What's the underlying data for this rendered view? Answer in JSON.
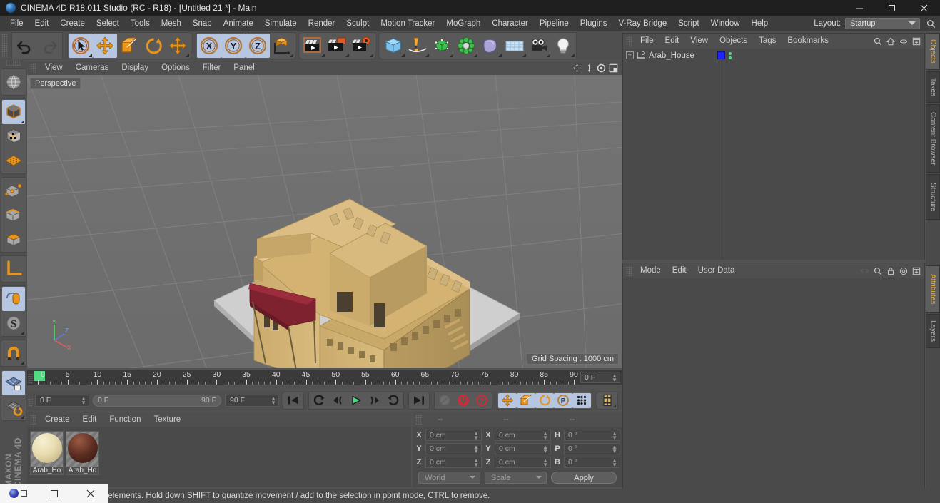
{
  "window": {
    "title": "CINEMA 4D R18.011 Studio (RC - R18) - [Untitled 21 *] - Main",
    "app_icon": "cinema4d-logo-icon",
    "minimize": "minimize-button",
    "maximize": "maximize-button",
    "close": "close-button"
  },
  "menubar": {
    "items": [
      "File",
      "Edit",
      "Create",
      "Select",
      "Tools",
      "Mesh",
      "Snap",
      "Animate",
      "Simulate",
      "Render",
      "Sculpt",
      "Motion Tracker",
      "MoGraph",
      "Character",
      "Pipeline",
      "Plugins",
      "V-Ray Bridge",
      "Script",
      "Window",
      "Help"
    ],
    "layout_label": "Layout:",
    "layout_value": "Startup",
    "search_icon": "search-icon"
  },
  "toolbar": {
    "groups": [
      {
        "name": "history",
        "buttons": [
          {
            "icon": "undo-icon",
            "label": "Undo",
            "selected": false,
            "dim": false
          },
          {
            "icon": "redo-icon",
            "label": "Redo",
            "selected": false,
            "dim": true
          }
        ]
      },
      {
        "name": "tools",
        "buttons": [
          {
            "icon": "live-selection-icon",
            "label": "Live Selection",
            "selected": true,
            "dim": false
          },
          {
            "icon": "move-icon",
            "label": "Move",
            "selected": true,
            "dim": false
          },
          {
            "icon": "scale-icon",
            "label": "Scale",
            "selected": false,
            "dim": false
          },
          {
            "icon": "rotate-icon",
            "label": "Rotate",
            "selected": false,
            "dim": false
          },
          {
            "icon": "move-alt-icon",
            "label": "Move Alt",
            "selected": false,
            "dim": false
          }
        ]
      },
      {
        "name": "axis-locks",
        "buttons": [
          {
            "icon": "axis-x-icon",
            "label": "X",
            "selected": true,
            "dim": false
          },
          {
            "icon": "axis-y-icon",
            "label": "Y",
            "selected": true,
            "dim": false
          },
          {
            "icon": "axis-z-icon",
            "label": "Z",
            "selected": true,
            "dim": false
          },
          {
            "icon": "world-coordinates-icon",
            "label": "World / Object",
            "selected": false,
            "dim": false
          }
        ]
      },
      {
        "name": "render",
        "buttons": [
          {
            "icon": "render-view-icon",
            "label": "Render View",
            "selected": false,
            "dim": false
          },
          {
            "icon": "render-picture-viewer-icon",
            "label": "Render to Picture Viewer",
            "selected": false,
            "dim": false
          },
          {
            "icon": "render-settings-icon",
            "label": "Edit Render Settings",
            "selected": false,
            "dim": false
          }
        ]
      },
      {
        "name": "create",
        "buttons": [
          {
            "icon": "cube-primitive-icon",
            "label": "Cube",
            "selected": false,
            "dim": false
          },
          {
            "icon": "spline-pen-icon",
            "label": "Pen",
            "selected": false,
            "dim": false
          },
          {
            "icon": "nurbs-icon",
            "label": "Subdivision Surface",
            "selected": false,
            "dim": false
          },
          {
            "icon": "mograph-icon",
            "label": "MoGraph",
            "selected": false,
            "dim": false
          },
          {
            "icon": "deformer-icon",
            "label": "Bend Deformer",
            "selected": false,
            "dim": false
          },
          {
            "icon": "environment-icon",
            "label": "Floor / Environment",
            "selected": false,
            "dim": false
          },
          {
            "icon": "camera-icon",
            "label": "Camera",
            "selected": false,
            "dim": false
          },
          {
            "icon": "light-icon",
            "label": "Light",
            "selected": false,
            "dim": false
          }
        ]
      }
    ]
  },
  "left_toolbar": {
    "groups": [
      [
        {
          "icon": "uv-texture-icon",
          "label": "Texture Mode",
          "selected": false
        }
      ],
      [
        {
          "icon": "object-mode-icon",
          "label": "Model Mode",
          "selected": true
        },
        {
          "icon": "texture-mode-icon",
          "label": "Texture Mode",
          "selected": false
        },
        {
          "icon": "workplane-icon",
          "label": "Workplane",
          "selected": false
        }
      ],
      [
        {
          "icon": "point-mode-icon",
          "label": "Points",
          "selected": false
        },
        {
          "icon": "edge-mode-icon",
          "label": "Edges",
          "selected": false
        },
        {
          "icon": "polygon-mode-icon",
          "label": "Polygons",
          "selected": false
        }
      ],
      [
        {
          "icon": "axis-modify-icon",
          "label": "Enable Axis Modification",
          "selected": false
        }
      ],
      [
        {
          "icon": "viewport-solo-icon",
          "label": "Enable Snapping",
          "selected": true
        },
        {
          "icon": "snap-s-icon",
          "label": "Snap Settings",
          "selected": true
        }
      ],
      [
        {
          "icon": "magnet-icon",
          "label": "Magnet Tool",
          "selected": false
        }
      ],
      [
        {
          "icon": "workplane-lock-icon",
          "label": "Lock Workplane",
          "selected": true
        },
        {
          "icon": "workplane-align-icon",
          "label": "Align Workplane",
          "selected": false
        }
      ]
    ],
    "brand_line1": "MAXON",
    "brand_line2": "CINEMA 4D"
  },
  "viewport": {
    "menu": [
      "View",
      "Cameras",
      "Display",
      "Options",
      "Filter",
      "Panel"
    ],
    "nav_icons": [
      "pan-icon",
      "dolly-icon",
      "rotate-view-icon",
      "maximize-view-icon"
    ],
    "camera_label": "Perspective",
    "grid_spacing": "Grid Spacing : 1000 cm",
    "axis_labels": {
      "x": "X",
      "y": "Y",
      "z": "Z"
    },
    "scene_description": "Arab house 3D model — sand-colored multi-story building with dark red awning on a grey ground plane"
  },
  "timeline": {
    "start_frame_label": "0 F",
    "range_start": "0 F",
    "range_end": "90 F",
    "end_frame_label": "90 F",
    "current_frame": "0 F",
    "ruler_min": 0,
    "ruler_max": 90,
    "major_ticks": [
      0,
      5,
      10,
      15,
      20,
      25,
      30,
      35,
      40,
      45,
      50,
      55,
      60,
      65,
      70,
      75,
      80,
      85,
      90
    ]
  },
  "animation_bar": {
    "transport": [
      {
        "icon": "go-to-start-icon",
        "label": "Go to Start",
        "selected": false,
        "dim": false
      },
      {
        "icon": "loop-icon",
        "label": "Play Mode / Loop",
        "selected": false,
        "dim": false
      },
      {
        "icon": "step-back-icon",
        "label": "Go to Previous Frame",
        "selected": false,
        "dim": false
      },
      {
        "icon": "play-icon",
        "label": "Play Forwards",
        "selected": false,
        "dim": false
      },
      {
        "icon": "step-forward-icon",
        "label": "Go to Next Frame",
        "selected": false,
        "dim": false
      },
      {
        "icon": "loop-back-icon",
        "label": "Play Backwards",
        "selected": false,
        "dim": false
      },
      {
        "icon": "go-to-end-icon",
        "label": "Go to End",
        "selected": false,
        "dim": false
      }
    ],
    "keys": [
      {
        "icon": "record-disabled-icon",
        "label": "Autokeying",
        "selected": false,
        "dim": true
      },
      {
        "icon": "record-active-icon",
        "label": "Record Active Objects",
        "selected": false,
        "dim": false
      },
      {
        "icon": "autokey-icon",
        "label": "Auto Keyframing",
        "selected": false,
        "dim": false
      }
    ],
    "key_filters": [
      {
        "icon": "key-position-icon",
        "label": "Position",
        "selected": true,
        "dim": false
      },
      {
        "icon": "key-scale-icon",
        "label": "Scale",
        "selected": true,
        "dim": false
      },
      {
        "icon": "key-rotation-icon",
        "label": "Rotation",
        "selected": true,
        "dim": false
      },
      {
        "icon": "key-parameter-icon",
        "label": "Parameter",
        "selected": true,
        "dim": false
      },
      {
        "icon": "key-pla-icon",
        "label": "Point Level Animation",
        "selected": true,
        "dim": false
      }
    ],
    "extra": [
      {
        "icon": "timeline-toggle-icon",
        "label": "Keyframe Selection",
        "selected": false,
        "dim": false
      }
    ]
  },
  "materials": {
    "menu": [
      "Create",
      "Edit",
      "Function",
      "Texture"
    ],
    "items": [
      {
        "name": "Arab_Ho",
        "color": "#e8dcb0",
        "kind": "sand-material"
      },
      {
        "name": "Arab_Ho",
        "color": "#5c2e22",
        "kind": "wood-material"
      }
    ]
  },
  "coordinates": {
    "headers": [
      "--",
      "--",
      "--"
    ],
    "rows": [
      {
        "l1": "X",
        "v1": "0 cm",
        "l2": "X",
        "v2": "0 cm",
        "l3": "H",
        "v3": "0 °"
      },
      {
        "l1": "Y",
        "v1": "0 cm",
        "l2": "Y",
        "v2": "0 cm",
        "l3": "P",
        "v3": "0 °"
      },
      {
        "l1": "Z",
        "v1": "0 cm",
        "l2": "Z",
        "v2": "0 cm",
        "l3": "B",
        "v3": "0 °"
      }
    ],
    "system": "World",
    "mode": "Scale",
    "apply": "Apply"
  },
  "object_manager": {
    "menu": [
      "File",
      "Edit",
      "View",
      "Objects",
      "Tags",
      "Bookmarks"
    ],
    "icons": [
      "search-icon",
      "home-icon",
      "minus-icon",
      "add-icon"
    ],
    "rows": [
      {
        "name": "Arab_House",
        "icon": "null-object-icon",
        "expand": "+",
        "tag_color": "#1d25ff",
        "dot_color": "#4ddc82"
      }
    ]
  },
  "attribute_manager": {
    "menu": [
      "Mode",
      "Edit",
      "User Data"
    ],
    "icons": [
      "search-icon",
      "lock-icon",
      "target-icon",
      "add-icon"
    ]
  },
  "dock_tabs": {
    "top": [
      {
        "label": "Objects",
        "active": true
      },
      {
        "label": "Takes",
        "active": false
      },
      {
        "label": "Content Browser",
        "active": false
      },
      {
        "label": "Structure",
        "active": false
      }
    ],
    "bottom": [
      {
        "label": "Attributes",
        "active": true
      },
      {
        "label": "Layers",
        "active": false
      }
    ]
  },
  "statusbar": {
    "text": "move elements. Hold down SHIFT to quantize movement / add to the selection in point mode, CTRL to remove."
  },
  "taskbar": {
    "items": [
      {
        "icon": "cinema4d-taskbar-icon",
        "label": "Cinema 4D"
      },
      {
        "icon": "restore-window-icon",
        "label": "Restore"
      },
      {
        "icon": "close-window-icon",
        "label": "Close"
      }
    ]
  },
  "colors": {
    "panel_bg": "#4a4a4a",
    "toolbar_bg": "#4f4f4f",
    "titlebar_bg": "#1f1f1f",
    "accent_orange": "#e69020",
    "selected_blue": "#b6c6e0",
    "green": "#4ddc82",
    "viewport_bg": "#6e6e6e"
  }
}
